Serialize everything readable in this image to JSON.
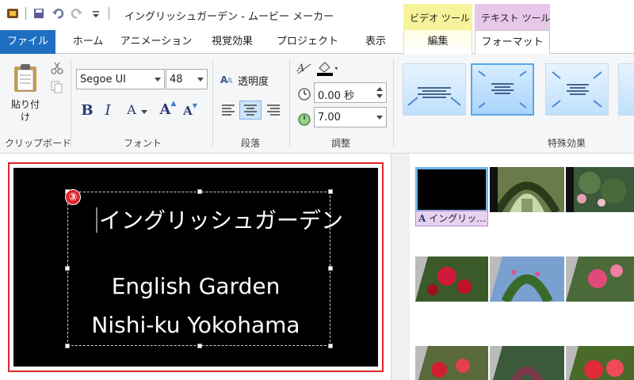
{
  "window": {
    "title": "イングリッシュガーデン - ムービー メーカー"
  },
  "context_tabs": {
    "video_tools": "ビデオ ツール",
    "text_tools": "テキスト ツール"
  },
  "tabs": [
    "ファイル",
    "ホーム",
    "アニメーション",
    "視覚効果",
    "プロジェクト",
    "表示",
    "編集",
    "フォーマット"
  ],
  "ribbon": {
    "clipboard": {
      "paste_label": "貼り付け",
      "group_label": "クリップボード"
    },
    "font": {
      "family": "Segoe UI",
      "size": "48",
      "group_label": "フォント"
    },
    "paragraph": {
      "transparency_label": "透明度",
      "group_label": "段落"
    },
    "adjust": {
      "start_time": "0.00 秒",
      "duration": "7.00",
      "group_label": "調整"
    },
    "effects": {
      "group_label": "特殊効果"
    }
  },
  "preview": {
    "badge": "③",
    "line1": "イングリッシュガーデン",
    "line2": "English Garden",
    "line3": "Nishi-ku Yokohama"
  },
  "storyboard": {
    "caption_chip": "イングリッ…"
  },
  "colors": {
    "file_tab": "#1e6fc2",
    "video_tools": "#f7f39b",
    "text_tools": "#e7c7ea",
    "highlight_frame": "#e0232a"
  }
}
